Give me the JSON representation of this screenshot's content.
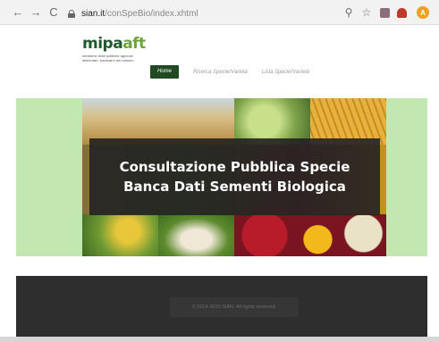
{
  "browser": {
    "nav": {
      "back": "←",
      "forward": "→",
      "reload": "C"
    },
    "url": {
      "host": "sian.it",
      "path": "/conSpeBio/index.xhtml"
    },
    "icons": [
      "search-icon",
      "star-icon",
      "extension-icon",
      "extension-icon",
      "profile-avatar"
    ],
    "search_glyph": "⚲",
    "star_glyph": "☆",
    "avatar_letter": "A",
    "ext_colors": [
      "#8b6d7d",
      "#c0392b"
    ]
  },
  "site": {
    "logo": {
      "word_main": "mipa",
      "word_accent": "aft",
      "subtitle": "ministero delle politiche agricole alimentari, forestali e del turismo"
    },
    "menu": [
      {
        "label": "Home",
        "active": true
      },
      {
        "label": "Ricerca Specie/Varietà",
        "active": false
      },
      {
        "label": "Lista Specie/Varietà",
        "active": false
      }
    ],
    "hero": {
      "title_line1": "Consultazione Pubblica Specie",
      "title_line2": "Banca Dati Sementi Biologica"
    },
    "footer": {
      "copyright": "© 2014-2019 SIAN. All rights reserved."
    }
  },
  "colors": {
    "hero_band": "#c2e7b0",
    "menu_active": "#1f4a22",
    "footer": "#2e2e2e",
    "logo_dark": "#1e5a2a",
    "logo_light": "#6ea33c"
  }
}
